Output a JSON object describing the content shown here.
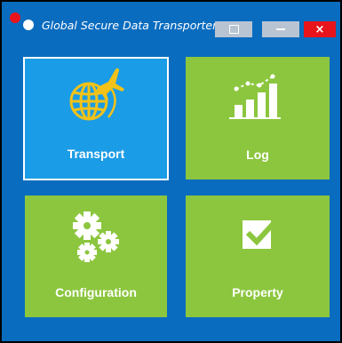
{
  "window": {
    "title": "Global Secure Data Transporter",
    "close_symbol": "×"
  },
  "tiles": [
    {
      "label": "Transport",
      "icon": "globe-airplane-icon",
      "selected": true
    },
    {
      "label": "Log",
      "icon": "bar-chart-icon",
      "selected": false
    },
    {
      "label": "Configuration",
      "icon": "gears-icon",
      "selected": false
    },
    {
      "label": "Property",
      "icon": "checkbox-icon",
      "selected": false
    }
  ],
  "colors": {
    "background": "#0a6cbf",
    "tile_selected": "#1b9ce6",
    "tile": "#8cc63f",
    "icon_transport": "#f2c218",
    "close_button": "#e8141c",
    "title_button": "#b9c4d2"
  }
}
